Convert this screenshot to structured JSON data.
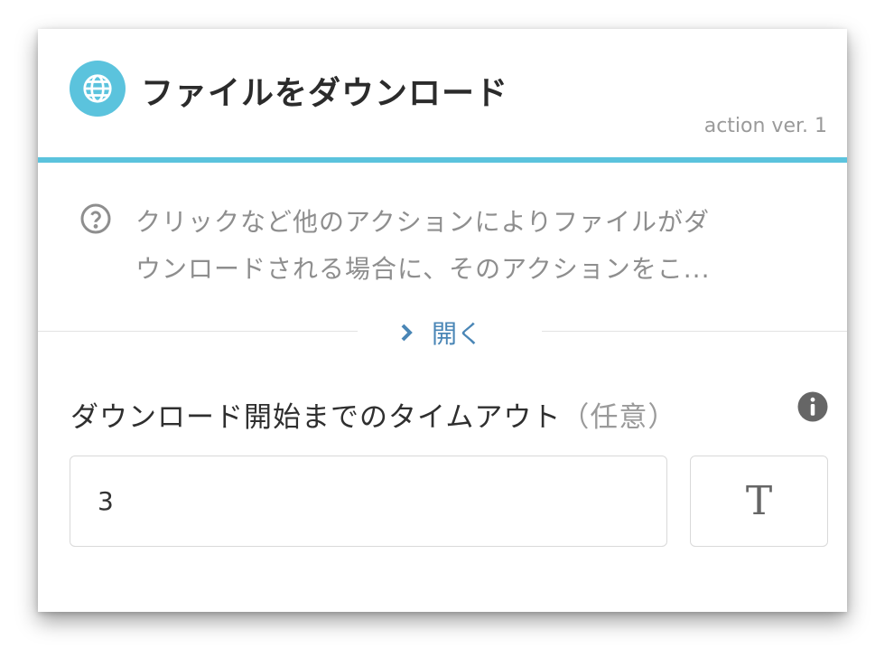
{
  "header": {
    "icon": "globe-icon",
    "title": "ファイルをダウンロード",
    "version": "action ver. 1",
    "accent_color": "#5bc3dd"
  },
  "description": {
    "icon": "help-circle-icon",
    "line1": "クリックなど他のアクションによりファイルがダ",
    "line2": "ウンロードされる場合に、そのアクションをこ..."
  },
  "expand": {
    "icon": "chevron-right-icon",
    "label": "開く",
    "color": "#4a86b6"
  },
  "field": {
    "label": "ダウンロード開始までのタイムアウト",
    "optional": "（任意）",
    "info_icon": "info-icon",
    "value": "3",
    "type_toggle_label": "T"
  }
}
